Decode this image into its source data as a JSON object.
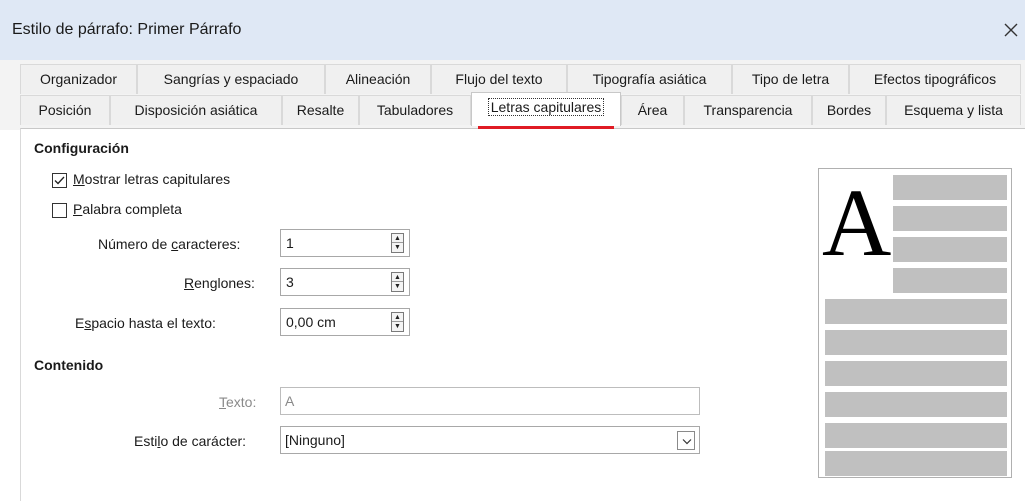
{
  "window": {
    "title": "Estilo de párrafo: Primer Párrafo",
    "close_icon": "close-icon"
  },
  "tabs": {
    "row1": [
      "Organizador",
      "Sangrías y espaciado",
      "Alineación",
      "Flujo del texto",
      "Tipografía asiática",
      "Tipo de letra",
      "Efectos tipográficos"
    ],
    "row2": [
      "Posición",
      "Disposición asiática",
      "Resalte",
      "Tabuladores",
      "Letras capitulares",
      "Área",
      "Transparencia",
      "Bordes",
      "Esquema y lista"
    ],
    "active": "Letras capitulares",
    "accent_color": "#e01b24"
  },
  "settings": {
    "heading": "Configuración",
    "show_dropcaps": {
      "label_mn": "M",
      "label_rest": "ostrar letras capitulares",
      "checked": true
    },
    "whole_word": {
      "label_mn": "P",
      "label_rest": "alabra completa",
      "checked": false
    },
    "num_chars": {
      "label_pre": "Número de ",
      "label_mn": "c",
      "label_post": "aracteres:",
      "value": "1"
    },
    "lines": {
      "label_mn": "R",
      "label_rest": "englones:",
      "value": "3"
    },
    "spacing": {
      "label_pre": "E",
      "label_mn": "s",
      "label_post": "pacio hasta el texto:",
      "value": "0,00 cm"
    }
  },
  "contents": {
    "heading": "Contenido",
    "text": {
      "label_mn": "T",
      "label_rest": "exto:",
      "value": "A"
    },
    "char_style": {
      "label_pre": "Esti",
      "label_mn": "l",
      "label_post": "o de carácter:",
      "value": "[Ninguno]"
    }
  },
  "preview": {
    "drop_letter": "A",
    "line_color": "#c0c0c0"
  }
}
